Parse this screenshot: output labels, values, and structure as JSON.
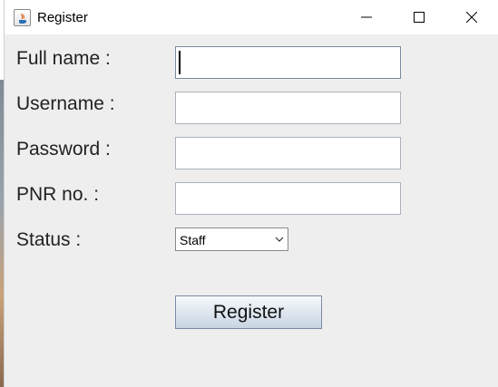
{
  "window": {
    "title": "Register",
    "controls": {
      "minimize": "minimize",
      "maximize": "maximize",
      "close": "close"
    }
  },
  "form": {
    "fields": [
      {
        "label": "Full name :",
        "value": ""
      },
      {
        "label": "Username :",
        "value": ""
      },
      {
        "label": "Password :",
        "value": ""
      },
      {
        "label": "PNR no. :",
        "value": ""
      }
    ],
    "status": {
      "label": "Status :",
      "selected": "Staff"
    },
    "submit_label": "Register"
  }
}
